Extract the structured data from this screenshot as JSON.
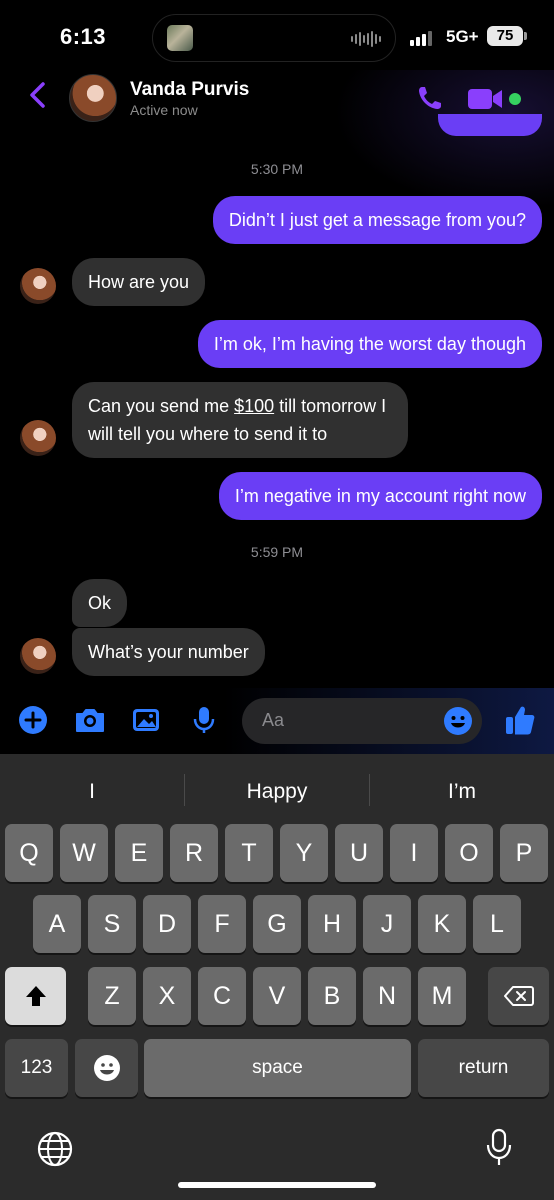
{
  "status_bar": {
    "time": "6:13",
    "network": "5G+",
    "battery": "75"
  },
  "header": {
    "contact_name": "Vanda Purvis",
    "presence": "Active now",
    "accent_color": "#7b3ff2",
    "online_color": "#36d160"
  },
  "messages": {
    "timestamp_1": "5:30 PM",
    "m1": "Didn’t I just get a message from you?",
    "m2": "How are you",
    "m3": "I’m ok, I’m having the worst day though",
    "m4_line1_a": "Can you send me ",
    "m4_line1_amount": "$100",
    "m4_line1_b": " till tomorrow I",
    "m4_line2": "will tell you where to send it to",
    "m5": "I’m negative in my account right now",
    "timestamp_2": "5:59 PM",
    "m6": "Ok",
    "m7": "What’s your number",
    "outgoing_color": "#6a3ef5",
    "incoming_color": "#303030"
  },
  "composer": {
    "placeholder": "Aa",
    "icons": [
      "plus-icon",
      "camera-icon",
      "image-icon",
      "microphone-icon",
      "emoji-icon",
      "thumbs-up-icon"
    ],
    "icon_color": "#2f7bff"
  },
  "keyboard": {
    "suggestions": [
      "I",
      "Happy",
      "I’m"
    ],
    "row1": [
      "Q",
      "W",
      "E",
      "R",
      "T",
      "Y",
      "U",
      "I",
      "O",
      "P"
    ],
    "row2": [
      "A",
      "S",
      "D",
      "F",
      "G",
      "H",
      "J",
      "K",
      "L"
    ],
    "row3": [
      "Z",
      "X",
      "C",
      "V",
      "B",
      "N",
      "M"
    ],
    "numbers_label": "123",
    "space_label": "space",
    "return_label": "return"
  }
}
